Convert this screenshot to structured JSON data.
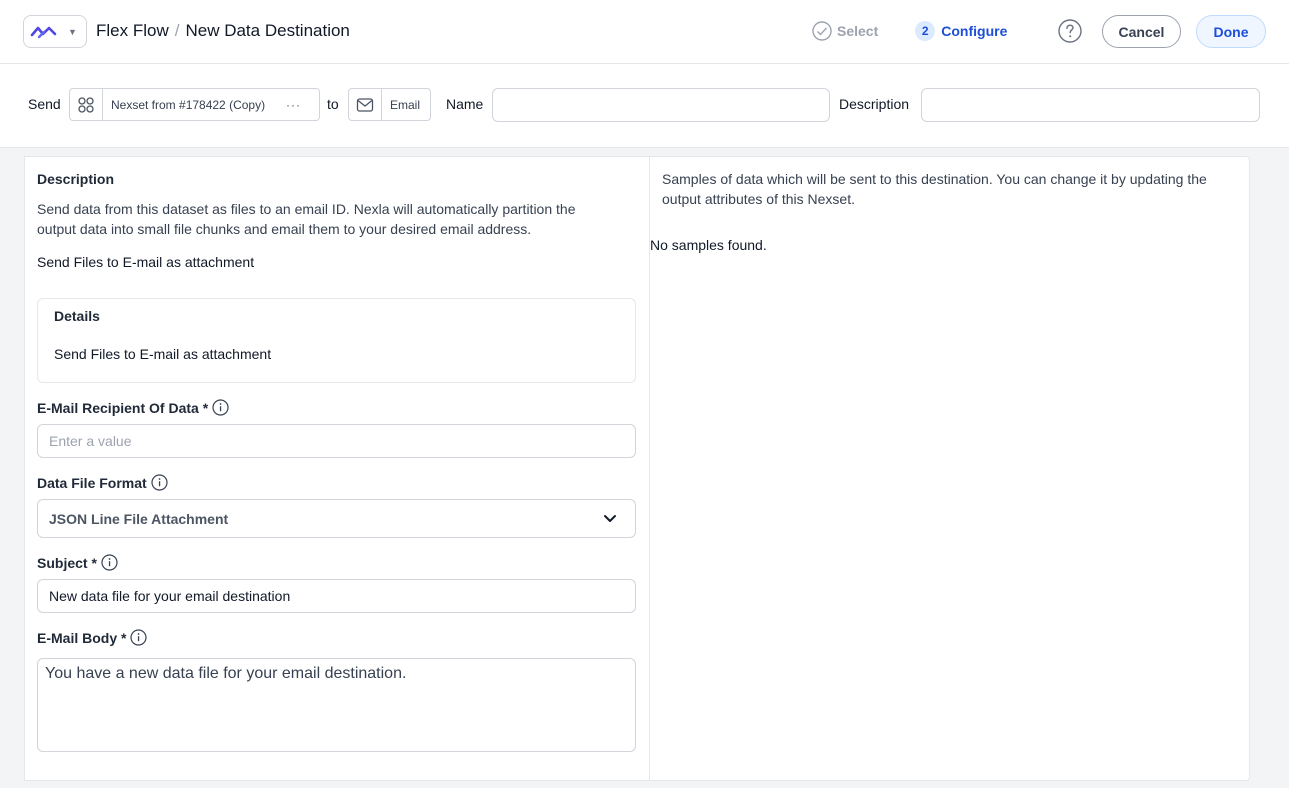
{
  "header": {
    "breadcrumb_root": "Flex Flow",
    "breadcrumb_sep": "/",
    "page_title": "New Data Destination",
    "steps": [
      {
        "label": "Select",
        "state": "completed"
      },
      {
        "number": "2",
        "label": "Configure",
        "state": "active"
      }
    ],
    "cancel_label": "Cancel",
    "done_label": "Done",
    "accent_color": "#1d4ed8"
  },
  "sendbar": {
    "send_label": "Send",
    "source_name": "Nexset from #178422 (Copy)",
    "source_more": "···",
    "to_label": "to",
    "destination_name": "Email",
    "name_label": "Name",
    "name_value": "",
    "description_label": "Description",
    "description_value": ""
  },
  "left": {
    "description_title": "Description",
    "description_line1": "Send data from this dataset as files to an email ID. Nexla will automatically partition the",
    "description_line2": "output data into small file chunks and email them to your desired email address.",
    "summary": "Send Files to E-mail as attachment",
    "details_title": "Details",
    "details_text": "Send Files to E-mail as attachment",
    "recipient_label": "E-Mail Recipient Of Data *",
    "recipient_placeholder": "Enter a value",
    "format_label": "Data File Format",
    "format_value": "JSON Line File Attachment",
    "subject_label": "Subject *",
    "subject_value": "New data file for your email destination",
    "body_label": "E-Mail Body *",
    "body_value": "You have a new data file for your email destination."
  },
  "right": {
    "samples_line1": "Samples of data which will be sent to this destination. You can change it by updating the",
    "samples_line2": "output attributes of this Nexset.",
    "empty_text": "No samples found."
  }
}
